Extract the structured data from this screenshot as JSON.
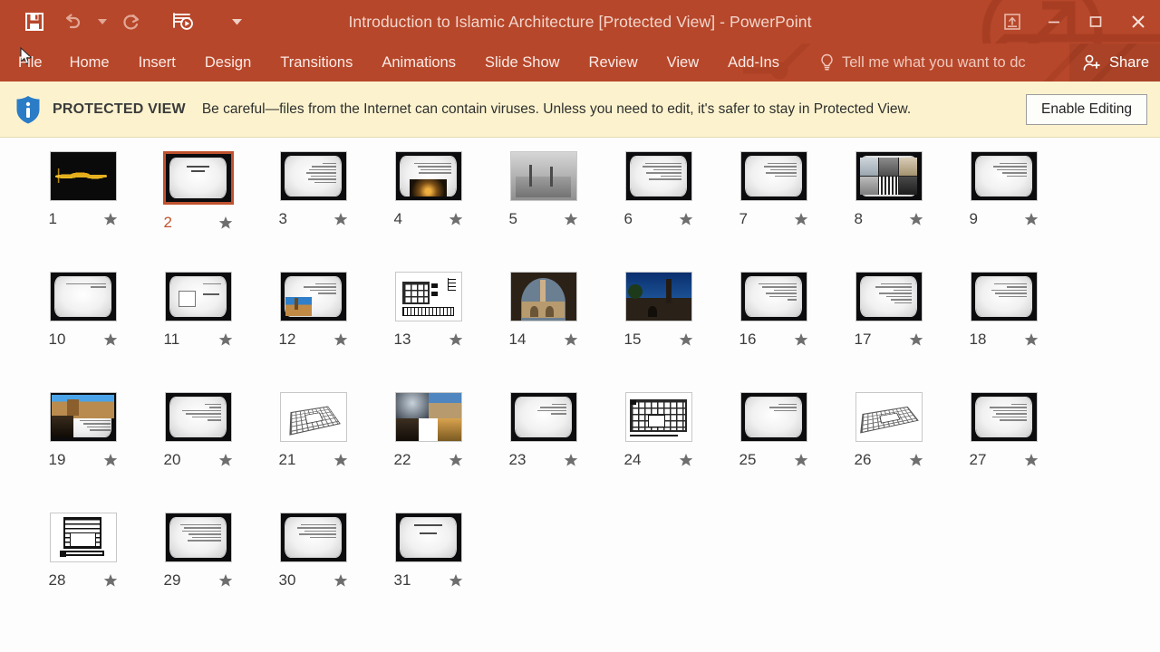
{
  "titlebar": {
    "document_title": "Introduction to Islamic Architecture [Protected View] - PowerPoint",
    "save_icon": "save-icon",
    "undo_icon": "undo-icon",
    "undo_dropdown_icon": "chevron-down-icon",
    "redo_icon": "redo-icon",
    "present_icon": "start-presentation-icon",
    "customize_qat_icon": "chevron-down-icon",
    "ribbon_display_icon": "ribbon-display-options-icon",
    "minimize_icon": "minimize-icon",
    "restore_icon": "restore-icon",
    "close_icon": "close-icon",
    "accent_color": "#b7472a"
  },
  "ribbon": {
    "tabs": [
      {
        "label": "File"
      },
      {
        "label": "Home"
      },
      {
        "label": "Insert"
      },
      {
        "label": "Design"
      },
      {
        "label": "Transitions"
      },
      {
        "label": "Animations"
      },
      {
        "label": "Slide Show"
      },
      {
        "label": "Review"
      },
      {
        "label": "View"
      },
      {
        "label": "Add-Ins"
      }
    ],
    "tell_me": {
      "label": "Tell me what you want to dc",
      "icon": "lightbulb-icon"
    },
    "share": {
      "label": "Share",
      "icon": "share-person-icon"
    }
  },
  "protected_view": {
    "icon": "info-shield-icon",
    "label": "PROTECTED VIEW",
    "message": "Be careful—files from the Internet can contain viruses. Unless you need to edit, it's safer to stay in Protected View.",
    "enable_button": "Enable Editing",
    "background_color": "#fcf3ce"
  },
  "slide_sorter": {
    "selected_slide": 2,
    "selection_color": "#c0522f",
    "animation_icon": "star-icon",
    "slides": [
      {
        "number": "1",
        "kind": "calligraphy"
      },
      {
        "number": "2",
        "kind": "frame-title"
      },
      {
        "number": "3",
        "kind": "frame-text"
      },
      {
        "number": "4",
        "kind": "frame-arch-photo"
      },
      {
        "number": "5",
        "kind": "photo-gray"
      },
      {
        "number": "6",
        "kind": "frame-text"
      },
      {
        "number": "7",
        "kind": "frame-text"
      },
      {
        "number": "8",
        "kind": "frame-collage"
      },
      {
        "number": "9",
        "kind": "frame-text"
      },
      {
        "number": "10",
        "kind": "frame-text-short"
      },
      {
        "number": "11",
        "kind": "frame-whitebox"
      },
      {
        "number": "12",
        "kind": "frame-minaret-photo"
      },
      {
        "number": "13",
        "kind": "plan-drawing"
      },
      {
        "number": "14",
        "kind": "photo-arch-minaret"
      },
      {
        "number": "15",
        "kind": "photo-minaret-sky"
      },
      {
        "number": "16",
        "kind": "frame-text"
      },
      {
        "number": "17",
        "kind": "frame-text"
      },
      {
        "number": "18",
        "kind": "frame-text"
      },
      {
        "number": "19",
        "kind": "frame-photo-text"
      },
      {
        "number": "20",
        "kind": "frame-text"
      },
      {
        "number": "21",
        "kind": "iso-drawing"
      },
      {
        "number": "22",
        "kind": "photo-collage"
      },
      {
        "number": "23",
        "kind": "frame-text-short"
      },
      {
        "number": "24",
        "kind": "plan-hypostyle"
      },
      {
        "number": "25",
        "kind": "frame-text-short"
      },
      {
        "number": "26",
        "kind": "iso-drawing"
      },
      {
        "number": "27",
        "kind": "frame-text"
      },
      {
        "number": "28",
        "kind": "plan-section"
      },
      {
        "number": "29",
        "kind": "frame-text"
      },
      {
        "number": "30",
        "kind": "frame-text"
      },
      {
        "number": "31",
        "kind": "frame-title"
      }
    ]
  }
}
